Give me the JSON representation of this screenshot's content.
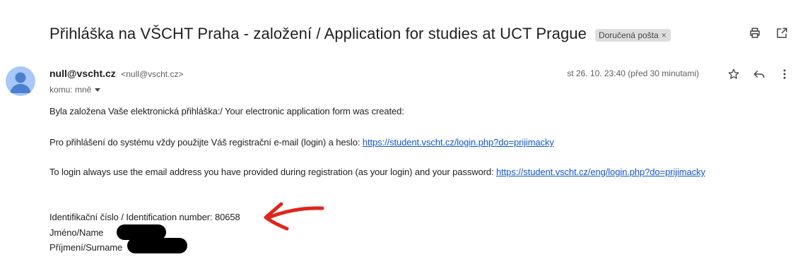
{
  "email": {
    "subject": "Přihláška na VŠCHT Praha - založení / Application for studies at UCT Prague",
    "label": "Doručená pošta",
    "label_remove": "×",
    "sender_name": "null@vscht.cz",
    "sender_email": "<null@vscht.cz>",
    "recipient": "komu: mně",
    "date": "st 26. 10. 23:40 (před 30 minutami)",
    "body": {
      "line1": "Byla založena Vaše elektronická přihláška:/ Your electronic application form was created:",
      "line2_text": "Pro přihlášení do systému vždy použijte Váš registrační e-mail (login) a heslo: ",
      "line2_link": "https://student.vscht.cz/login.php?do=prijimacky",
      "line3_text": "To login always use the email address you have provided during registration (as your login) and your password: ",
      "line3_link": "https://student.vscht.cz/eng/login.php?do=prijimacky",
      "id_line": "Identifikační číslo / Identification number: 80658",
      "name_label": "Jméno/Name",
      "surname_label": "Příjmení/Surname"
    }
  },
  "icons": {
    "print": "print-icon",
    "popout": "open-in-new-window-icon",
    "star": "star-icon",
    "reply": "reply-icon",
    "more": "more-vert-icon",
    "avatar": "default-avatar-icon",
    "annotation": "red-arrow-annotation"
  },
  "colors": {
    "link": "#1155cc",
    "avatar_bg": "#a8c7fa",
    "avatar_fg": "#4a7fcf",
    "annotation": "#e0251b",
    "chip_bg": "#dddddd"
  }
}
